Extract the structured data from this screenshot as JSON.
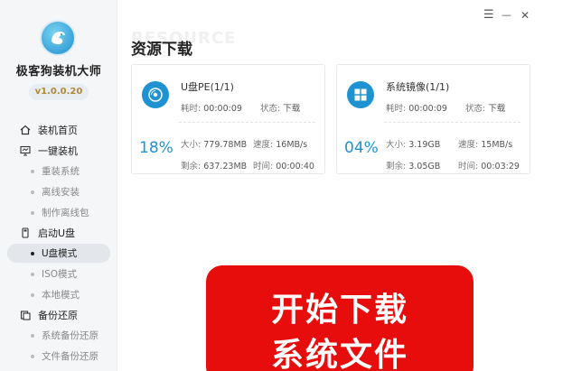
{
  "sidebar": {
    "app_name": "极客狗装机大师",
    "version": "v1.0.0.20",
    "home": "装机首页",
    "one_click": "一键装机",
    "one_click_items": [
      "重装系统",
      "离线安装",
      "制作离线包"
    ],
    "boot": "启动U盘",
    "boot_items": [
      "U盘模式",
      "ISO模式",
      "本地模式"
    ],
    "backup": "备份还原",
    "backup_items": [
      "系统备份还原",
      "文件备份还原"
    ]
  },
  "window": {
    "menu_glyph": "☰",
    "minimize_glyph": "—",
    "close_glyph": "✕"
  },
  "main": {
    "watermark": "RESOURCE",
    "title": "资源下载",
    "cards": [
      {
        "name": "U盘PE(1/1)",
        "elapsed_label": "耗时:",
        "elapsed": "00:00:09",
        "status_label": "状态:",
        "status": "下载",
        "percent": "18%",
        "size_label": "大小:",
        "size": "779.78MB",
        "speed_label": "速度:",
        "speed": "16MB/s",
        "remaining_label": "剩余:",
        "remaining": "637.23MB",
        "time_label": "时间:",
        "time": "00:00:40"
      },
      {
        "name": "系统镜像(1/1)",
        "elapsed_label": "耗时:",
        "elapsed": "00:00:09",
        "status_label": "状态:",
        "status": "下载",
        "percent": "04%",
        "size_label": "大小:",
        "size": "3.19GB",
        "speed_label": "速度:",
        "speed": "15MB/s",
        "remaining_label": "剩余:",
        "remaining": "3.05GB",
        "time_label": "时间:",
        "time": "00:03:29"
      }
    ]
  },
  "overlay": {
    "line1": "开始下载",
    "line2": "系统文件"
  },
  "colors": {
    "accent": "#1f93d2",
    "overlay": "#e70d0d",
    "sidebar_bg": "#f5f6f8"
  }
}
